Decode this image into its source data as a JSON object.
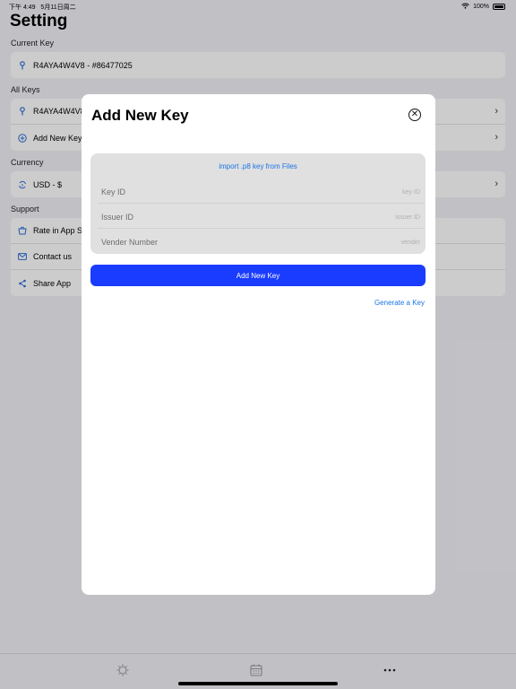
{
  "status_bar": {
    "time": "下午 4:49",
    "date": "5月11日周二",
    "battery": "100%"
  },
  "page": {
    "title": "Setting"
  },
  "current_key": {
    "section": "Current Key",
    "value": "R4AYA4W4V8 - #86477025"
  },
  "all_keys": {
    "section": "All Keys",
    "items": [
      "R4AYA4W4V8",
      "Add New Key"
    ]
  },
  "currency": {
    "section": "Currency",
    "value": "USD  -  $"
  },
  "support": {
    "section": "Support",
    "items": [
      "Rate in App Store",
      "Contact us",
      "Share App"
    ]
  },
  "modal": {
    "title": "Add New Key",
    "import_label": "import .p8 key from Files",
    "fields": [
      {
        "label": "Key ID",
        "placeholder": "key ID"
      },
      {
        "label": "Issuer ID",
        "placeholder": "issuer ID"
      },
      {
        "label": "Vender Number",
        "placeholder": "vender"
      }
    ],
    "submit_label": "Add New Key",
    "generate_label": "Generate a Key"
  },
  "tabbar": {
    "icons": [
      "sun-icon",
      "calendar-icon",
      "more-icon"
    ]
  },
  "colors": {
    "accent": "#1a3cff",
    "link": "#1a73e8",
    "icon": "#2f6fd8"
  }
}
